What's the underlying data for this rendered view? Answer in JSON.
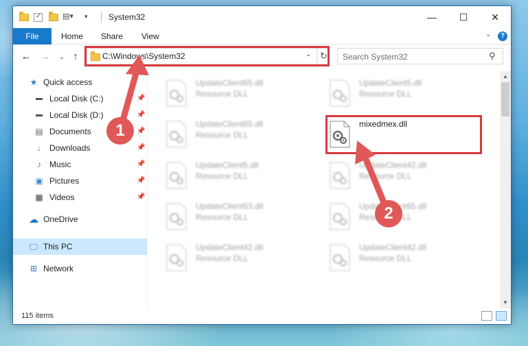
{
  "window": {
    "title": "System32",
    "controls": {
      "minimize": "—",
      "maximize": "☐",
      "close": "✕"
    }
  },
  "ribbon": {
    "tabs": [
      {
        "label": "File",
        "active": true
      },
      {
        "label": "Home"
      },
      {
        "label": "Share"
      },
      {
        "label": "View"
      }
    ],
    "help_label": "?"
  },
  "address": {
    "path": "C:\\Windows\\System32",
    "search_placeholder": "Search System32"
  },
  "nav_pane": {
    "items": [
      {
        "label": "Quick access",
        "icon": "star-icon"
      },
      {
        "label": "Local Disk (C:)",
        "icon": "drive-icon",
        "pinned": true
      },
      {
        "label": "Local Disk (D:)",
        "icon": "drive-icon",
        "pinned": true
      },
      {
        "label": "Documents",
        "icon": "documents-icon",
        "pinned": true
      },
      {
        "label": "Downloads",
        "icon": "downloads-icon",
        "pinned": true
      },
      {
        "label": "Music",
        "icon": "music-icon",
        "pinned": true
      },
      {
        "label": "Pictures",
        "icon": "pictures-icon",
        "pinned": true
      },
      {
        "label": "Videos",
        "icon": "videos-icon",
        "pinned": true
      },
      {
        "label": "OneDrive",
        "icon": "onedrive-icon"
      },
      {
        "label": "This PC",
        "icon": "computer-icon",
        "selected": true
      },
      {
        "label": "Network",
        "icon": "network-icon"
      }
    ]
  },
  "files": [
    {
      "name": "UpdateClient65.dll",
      "type": "Resource DLL",
      "blurred": true
    },
    {
      "name": "UpdateClient5.dll",
      "type": "Resource DLL",
      "blurred": true
    },
    {
      "name": "UpdateClient65.dll",
      "type": "Resource DLL",
      "blurred": true
    },
    {
      "name": "mixedmex.dll",
      "type": "",
      "blurred": false
    },
    {
      "name": "UpdateClient5.dll",
      "type": "Resource DLL",
      "blurred": true
    },
    {
      "name": "UpdateClient42.dll",
      "type": "Resource DLL",
      "blurred": true
    },
    {
      "name": "UpdateClient63.dll",
      "type": "Resource DLL",
      "blurred": true
    },
    {
      "name": "UpdateClient65.dll",
      "type": "Resource DLL",
      "blurred": true
    },
    {
      "name": "UpdateClient42.dll",
      "type": "Resource DLL",
      "blurred": true
    },
    {
      "name": "UpdateClient42.dll",
      "type": "Resource DLL",
      "blurred": true
    }
  ],
  "status": {
    "item_count": "115 items"
  },
  "callouts": [
    {
      "number": "1"
    },
    {
      "number": "2"
    }
  ],
  "colors": {
    "accent": "#1979ca",
    "highlight": "#d9393b",
    "callout": "#e05858",
    "selection": "#cce8ff"
  }
}
